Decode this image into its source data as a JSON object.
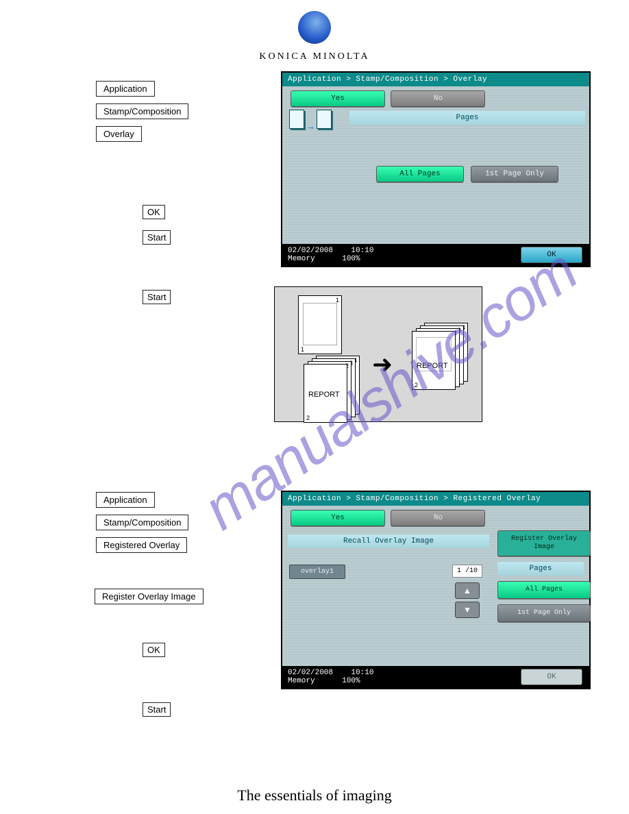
{
  "brand": {
    "name": "KONICA MINOLTA",
    "tagline": "The essentials of imaging"
  },
  "watermark": "manualshive.com",
  "section1": {
    "nav": [
      "Application",
      "Stamp/Composition",
      "Overlay"
    ],
    "ok_small": "OK",
    "start_small": "Start"
  },
  "section2": {
    "nav": [
      "Application",
      "Stamp/Composition",
      "Registered Overlay"
    ],
    "reg_button": "Register Overlay Image",
    "ok_small": "OK",
    "start_small": "Start"
  },
  "panel1": {
    "breadcrumb": "Application > Stamp/Composition > Overlay",
    "yes": "Yes",
    "no": "No",
    "pages_header": "Pages",
    "all_pages": "All Pages",
    "first_page": "1st Page Only",
    "status_date": "02/02/2008",
    "status_time": "10:10",
    "status_mem_label": "Memory",
    "status_mem_value": "100%",
    "ok": "OK"
  },
  "panel2": {
    "breadcrumb": "Application > Stamp/Composition > Registered Overlay",
    "yes": "Yes",
    "no": "No",
    "recall_header": "Recall Overlay Image",
    "register_label": "Register Overlay Image",
    "pages_header": "Pages",
    "all_pages": "All Pages",
    "first_page": "1st Page Only",
    "item1": "overlay1",
    "page_indicator": "1 /10",
    "status_date": "02/02/2008",
    "status_time": "10:10",
    "status_mem_label": "Memory",
    "status_mem_value": "100%",
    "ok": "OK"
  },
  "diagram": {
    "report_label": "REPORT"
  }
}
